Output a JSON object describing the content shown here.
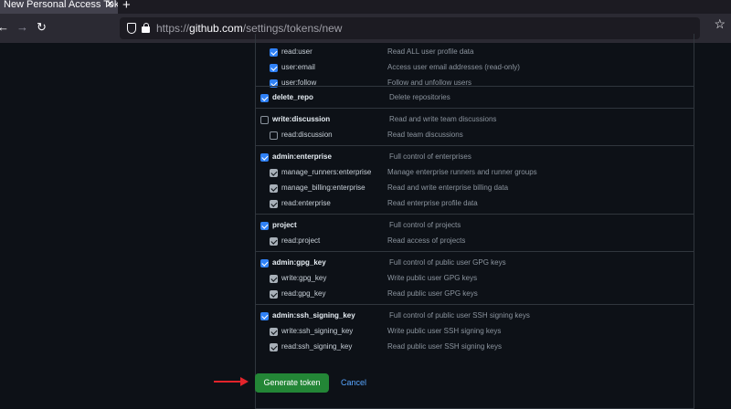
{
  "browser": {
    "tab_title": "New Personal Access Tokens",
    "url_prefix": "https://",
    "url_host": "github.com",
    "url_path": "/settings/tokens/new"
  },
  "scope_groups": [
    {
      "rows": [
        {
          "label": "read:user",
          "desc": "Read ALL user profile data",
          "checked": true,
          "child": true
        },
        {
          "label": "user:email",
          "desc": "Access user email addresses (read-only)",
          "checked": true,
          "child": true
        },
        {
          "label": "user:follow",
          "desc": "Follow and unfollow users",
          "checked": true,
          "child": true
        }
      ]
    },
    {
      "rows": [
        {
          "label": "delete_repo",
          "desc": "Delete repositories",
          "checked": true,
          "child": false
        }
      ]
    },
    {
      "rows": [
        {
          "label": "write:discussion",
          "desc": "Read and write team discussions",
          "checked": false,
          "child": false
        },
        {
          "label": "read:discussion",
          "desc": "Read team discussions",
          "checked": false,
          "child": true
        }
      ]
    },
    {
      "rows": [
        {
          "label": "admin:enterprise",
          "desc": "Full control of enterprises",
          "checked": true,
          "child": false
        },
        {
          "label": "manage_runners:enterprise",
          "desc": "Manage enterprise runners and runner groups",
          "checked": true,
          "child": true
        },
        {
          "label": "manage_billing:enterprise",
          "desc": "Read and write enterprise billing data",
          "checked": true,
          "child": true
        },
        {
          "label": "read:enterprise",
          "desc": "Read enterprise profile data",
          "checked": true,
          "child": true
        }
      ]
    },
    {
      "rows": [
        {
          "label": "project",
          "desc": "Full control of projects",
          "checked": true,
          "child": false
        },
        {
          "label": "read:project",
          "desc": "Read access of projects",
          "checked": true,
          "child": true
        }
      ]
    },
    {
      "rows": [
        {
          "label": "admin:gpg_key",
          "desc": "Full control of public user GPG keys",
          "checked": true,
          "child": false
        },
        {
          "label": "write:gpg_key",
          "desc": "Write public user GPG keys",
          "checked": true,
          "child": true
        },
        {
          "label": "read:gpg_key",
          "desc": "Read public user GPG keys",
          "checked": true,
          "child": true
        }
      ]
    },
    {
      "rows": [
        {
          "label": "admin:ssh_signing_key",
          "desc": "Full control of public user SSH signing keys",
          "checked": true,
          "child": false
        },
        {
          "label": "write:ssh_signing_key",
          "desc": "Write public user SSH signing keys",
          "checked": true,
          "child": true
        },
        {
          "label": "read:ssh_signing_key",
          "desc": "Read public user SSH signing keys",
          "checked": true,
          "child": true
        }
      ]
    }
  ],
  "actions": {
    "generate_label": "Generate token",
    "cancel_label": "Cancel"
  },
  "colors": {
    "generate": "#238636",
    "checkbox": "#2f81f7",
    "link": "#58a6ff",
    "arrow": "#e3242b"
  }
}
